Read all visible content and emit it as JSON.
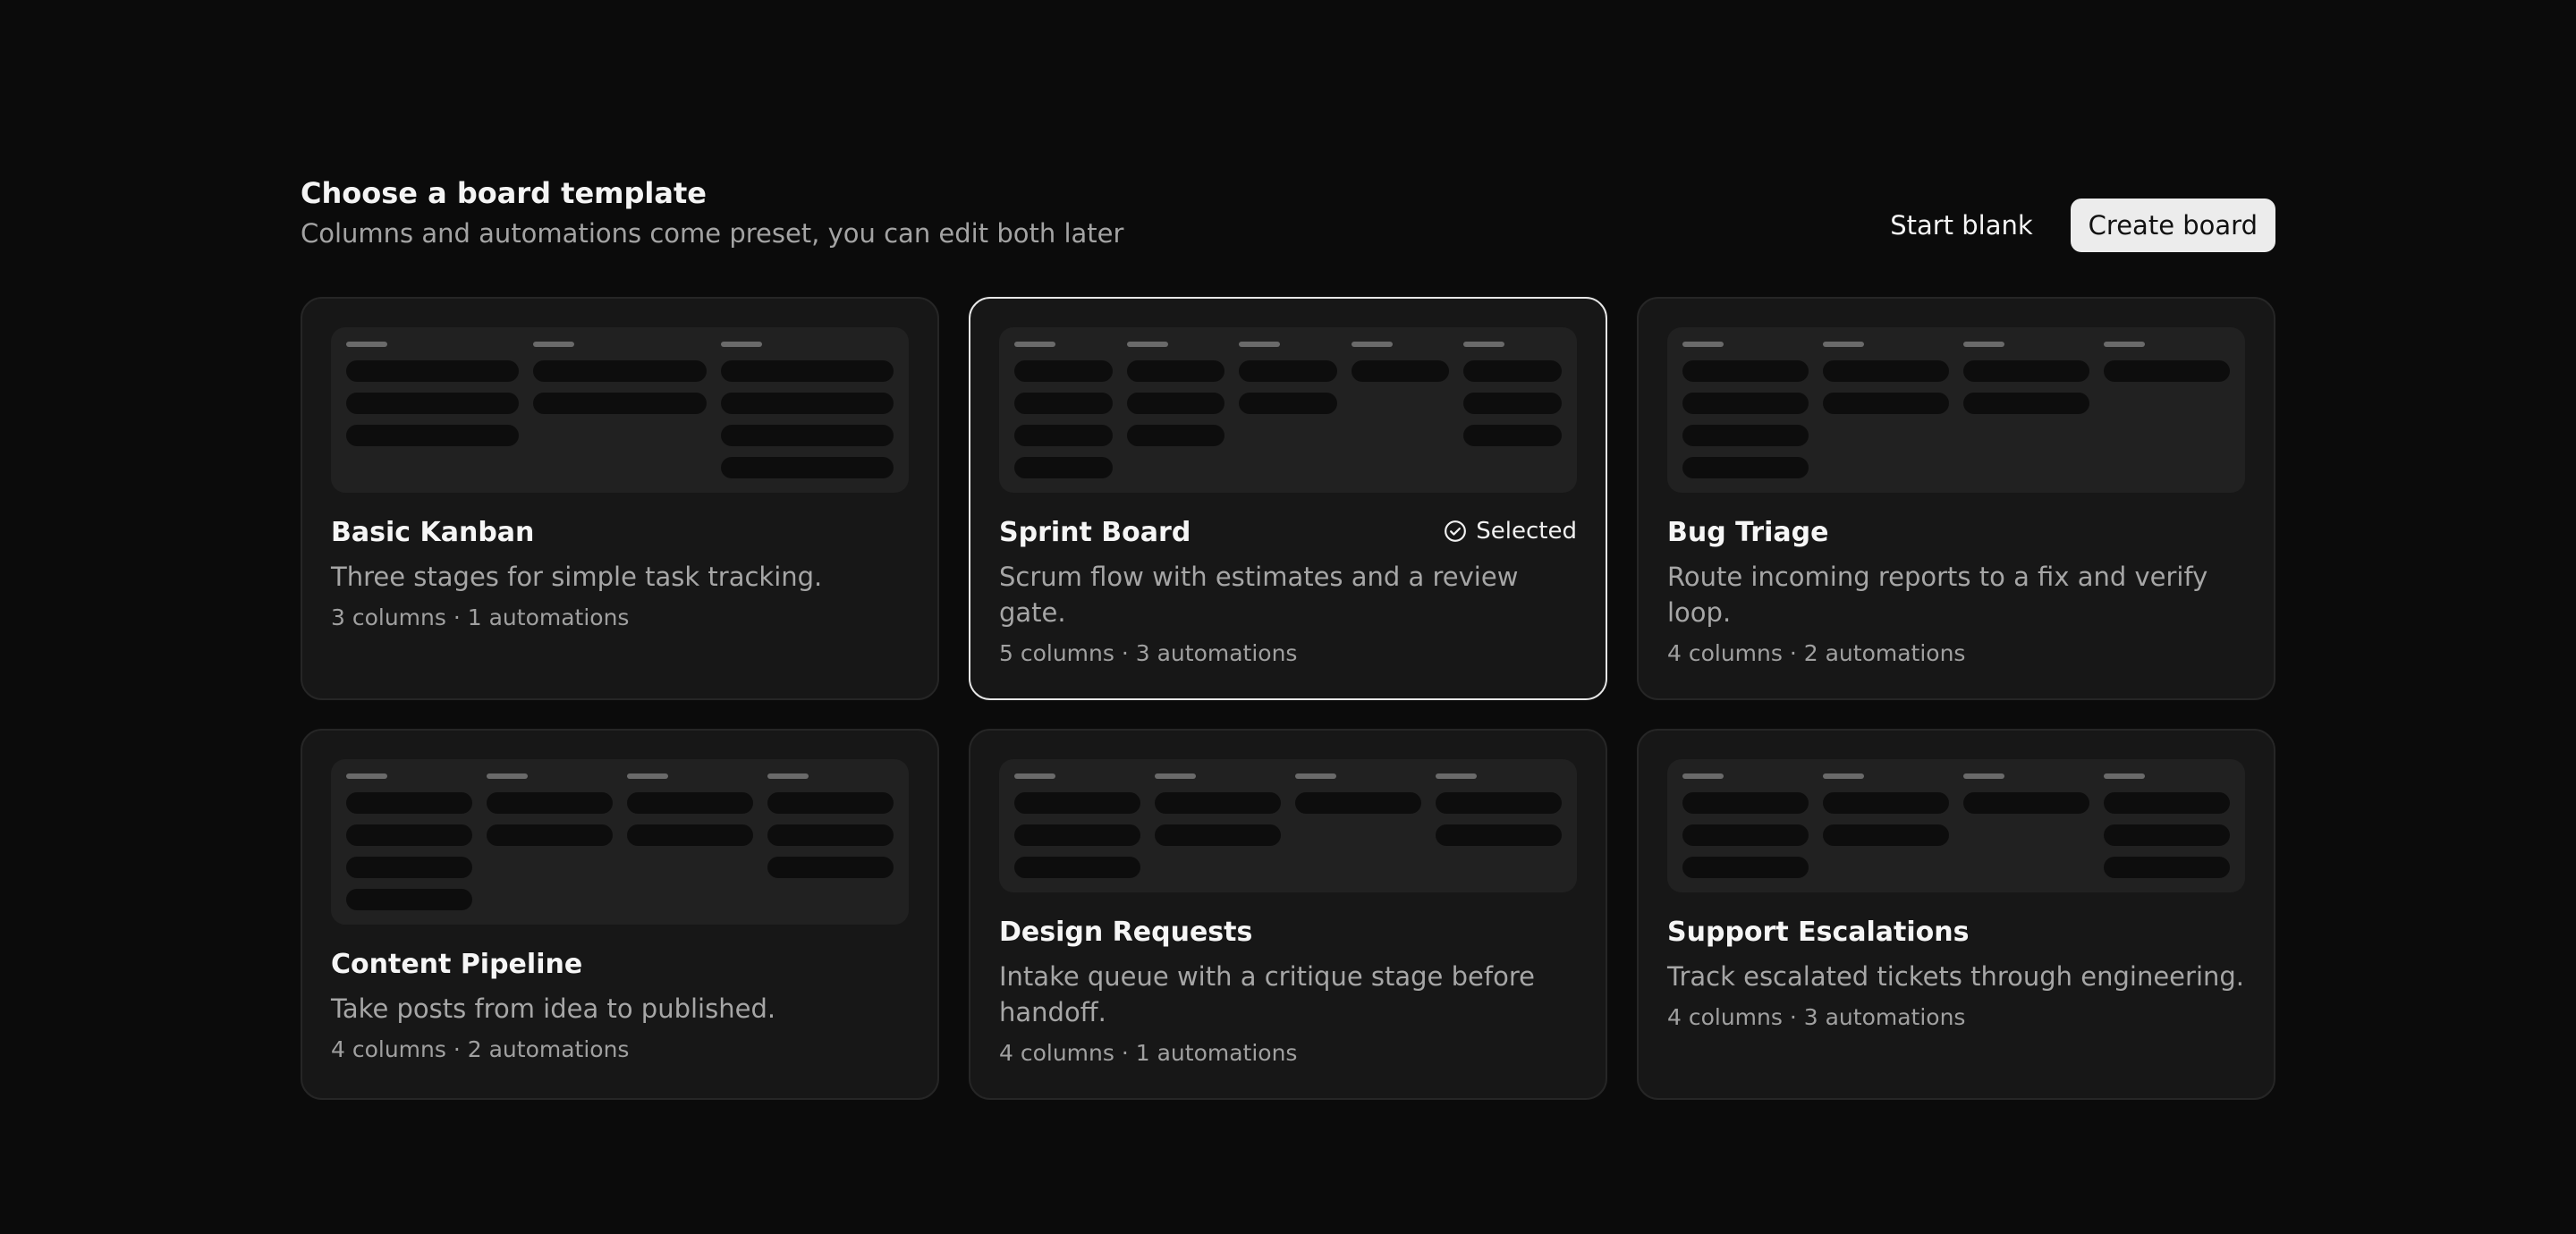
{
  "header": {
    "title": "Choose a board template",
    "subtitle": "Columns and automations come preset, you can edit both later",
    "start_blank_label": "Start blank",
    "create_board_label": "Create board"
  },
  "selected_badge": {
    "icon": "check-circle-icon",
    "label": "Selected"
  },
  "colors": {
    "background": "#0b0b0b",
    "card": "#171717",
    "selected_border": "#e6e6e6",
    "primary_button": "#ececec"
  },
  "templates": [
    {
      "id": "basic-kanban",
      "name": "Basic Kanban",
      "description": "Three stages for simple task tracking.",
      "meta": "3 columns · 1 automations",
      "selected": false,
      "preview_columns": [
        3,
        2,
        4
      ]
    },
    {
      "id": "sprint-board",
      "name": "Sprint Board",
      "description": "Scrum flow with estimates and a review gate.",
      "meta": "5 columns · 3 automations",
      "selected": true,
      "preview_columns": [
        4,
        3,
        2,
        1,
        3
      ]
    },
    {
      "id": "bug-triage",
      "name": "Bug Triage",
      "description": "Route incoming reports to a fix and verify loop.",
      "meta": "4 columns · 2 automations",
      "selected": false,
      "preview_columns": [
        4,
        2,
        2,
        1
      ]
    },
    {
      "id": "content-pipeline",
      "name": "Content Pipeline",
      "description": "Take posts from idea to published.",
      "meta": "4 columns · 2 automations",
      "selected": false,
      "preview_columns": [
        4,
        2,
        2,
        3
      ]
    },
    {
      "id": "design-requests",
      "name": "Design Requests",
      "description": "Intake queue with a critique stage before handoff.",
      "meta": "4 columns · 1 automations",
      "selected": false,
      "preview_columns": [
        3,
        2,
        1,
        2
      ]
    },
    {
      "id": "support-escalations",
      "name": "Support Escalations",
      "description": "Track escalated tickets through engineering.",
      "meta": "4 columns · 3 automations",
      "selected": false,
      "preview_columns": [
        3,
        2,
        1,
        3
      ]
    }
  ]
}
